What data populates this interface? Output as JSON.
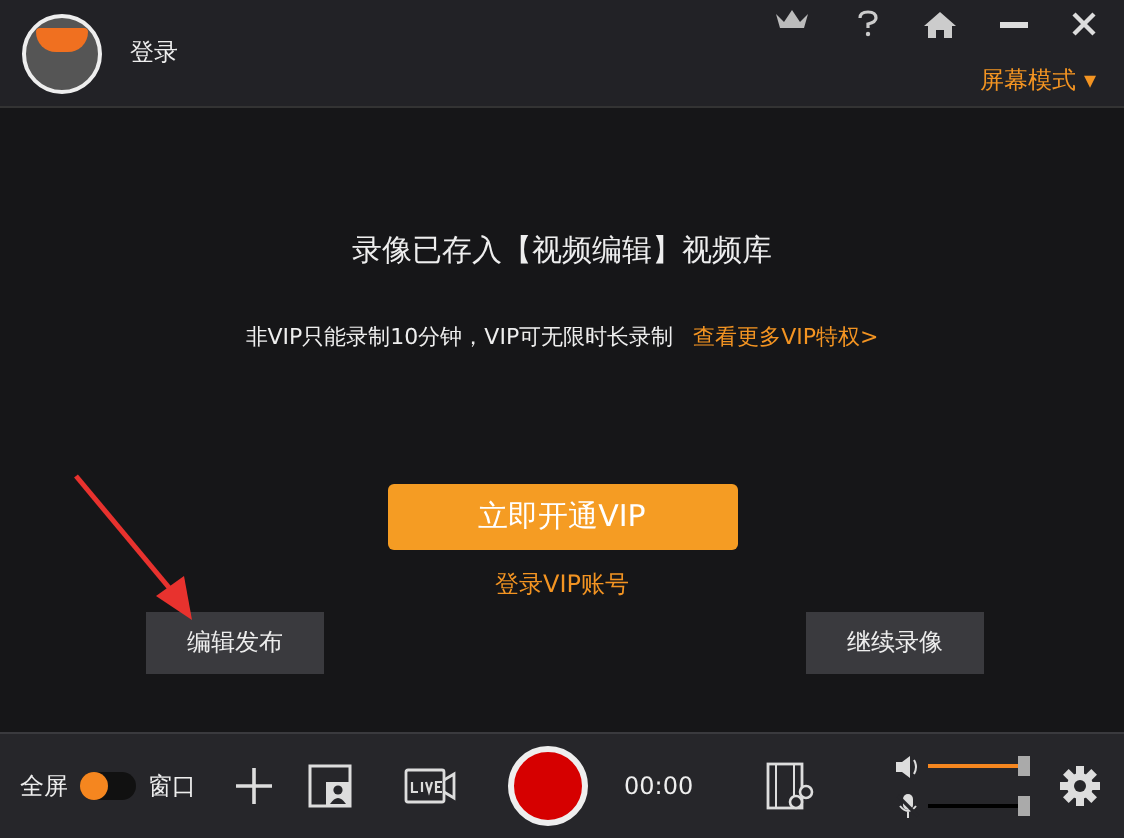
{
  "header": {
    "login": "登录",
    "mode_menu": "屏幕模式 ▾"
  },
  "message": {
    "title": "录像已存入【视频编辑】视频库",
    "notice": "非VIP只能录制10分钟，VIP可无限时长录制",
    "link": "查看更多VIP特权>"
  },
  "vip_button": "立即开通VIP",
  "vip_login": "登录VIP账号",
  "actions": [
    "编辑发布",
    "继续录像"
  ],
  "toolbar": {
    "fullscreen_label": "全屏",
    "window_label": "窗口",
    "window_mode": false,
    "timer": "00:00",
    "audio": [
      {
        "kind": "speaker",
        "muted": false,
        "level": 1.0
      },
      {
        "kind": "mic",
        "muted": true,
        "level": 1.0
      }
    ]
  }
}
